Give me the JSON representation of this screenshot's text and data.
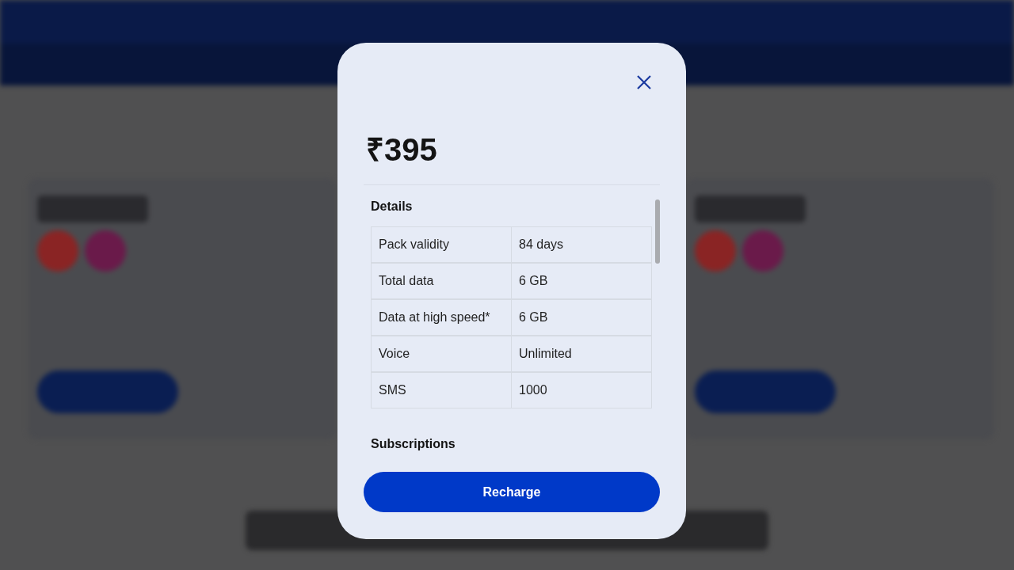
{
  "dialog": {
    "price": "₹395",
    "sections": [
      {
        "title": "Details",
        "rows": [
          {
            "label": "Pack validity",
            "value": "84 days"
          },
          {
            "label": "Total data",
            "value": "6 GB"
          },
          {
            "label": "Data at high speed*",
            "value": "6 GB"
          },
          {
            "label": "Voice",
            "value": "Unlimited"
          },
          {
            "label": "SMS",
            "value": "1000"
          }
        ]
      },
      {
        "title": "Subscriptions"
      }
    ],
    "button": "Recharge"
  }
}
